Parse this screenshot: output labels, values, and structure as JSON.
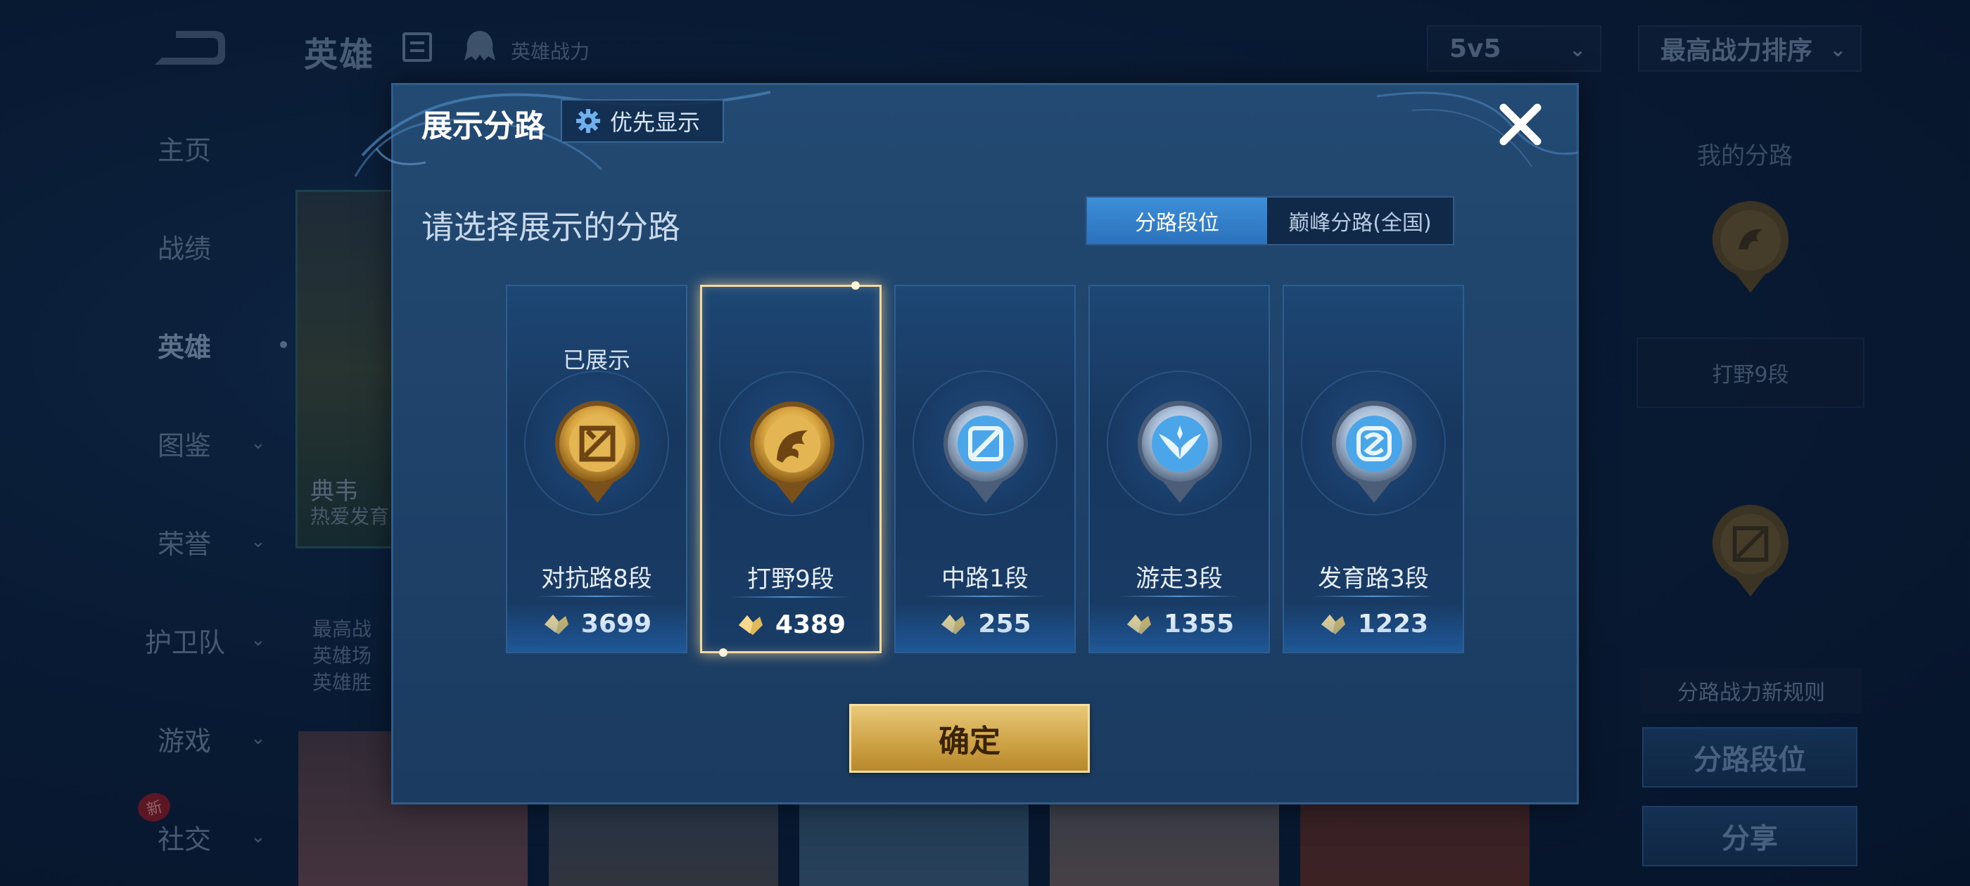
{
  "background": {
    "header_title": "英雄",
    "header_subtitle": "英雄战力",
    "mode_select": "5v5",
    "sort_select": "最高战力排序",
    "nav": [
      {
        "label": "主页"
      },
      {
        "label": "战绩"
      },
      {
        "label": "英雄"
      },
      {
        "label": "图鉴"
      },
      {
        "label": "荣誉"
      },
      {
        "label": "护卫队"
      },
      {
        "label": "游戏"
      },
      {
        "label": "社交"
      }
    ],
    "new_badge": "新",
    "hero_name": "典韦",
    "hero_desc": "热爱发育",
    "hero_stats": [
      "最高战",
      "英雄场",
      "英雄胜"
    ],
    "right_title": "我的分路",
    "right_field": "打野9段",
    "right_rule": "分路战力新规则",
    "right_btn1": "分路段位",
    "right_btn2": "分享"
  },
  "modal": {
    "title": "展示分路",
    "priority_btn": "优先显示",
    "prompt": "请选择展示的分路",
    "tabs": {
      "active": "分路段位",
      "inactive": "巅峰分路(全国)"
    },
    "lanes": [
      {
        "status": "已展示",
        "name": "对抗路8段",
        "power": "3699",
        "medal": "gold-fighter"
      },
      {
        "status": "",
        "name": "打野9段",
        "power": "4389",
        "medal": "gold-jungle"
      },
      {
        "status": "",
        "name": "中路1段",
        "power": "255",
        "medal": "silver-mid"
      },
      {
        "status": "",
        "name": "游走3段",
        "power": "1355",
        "medal": "silver-roam"
      },
      {
        "status": "",
        "name": "发育路3段",
        "power": "1223",
        "medal": "silver-adc"
      }
    ],
    "confirm": "确定"
  },
  "colors": {
    "gold": "#d6ab4f",
    "accent_blue": "#3d8ed8",
    "modal_bg": "#234a72"
  }
}
